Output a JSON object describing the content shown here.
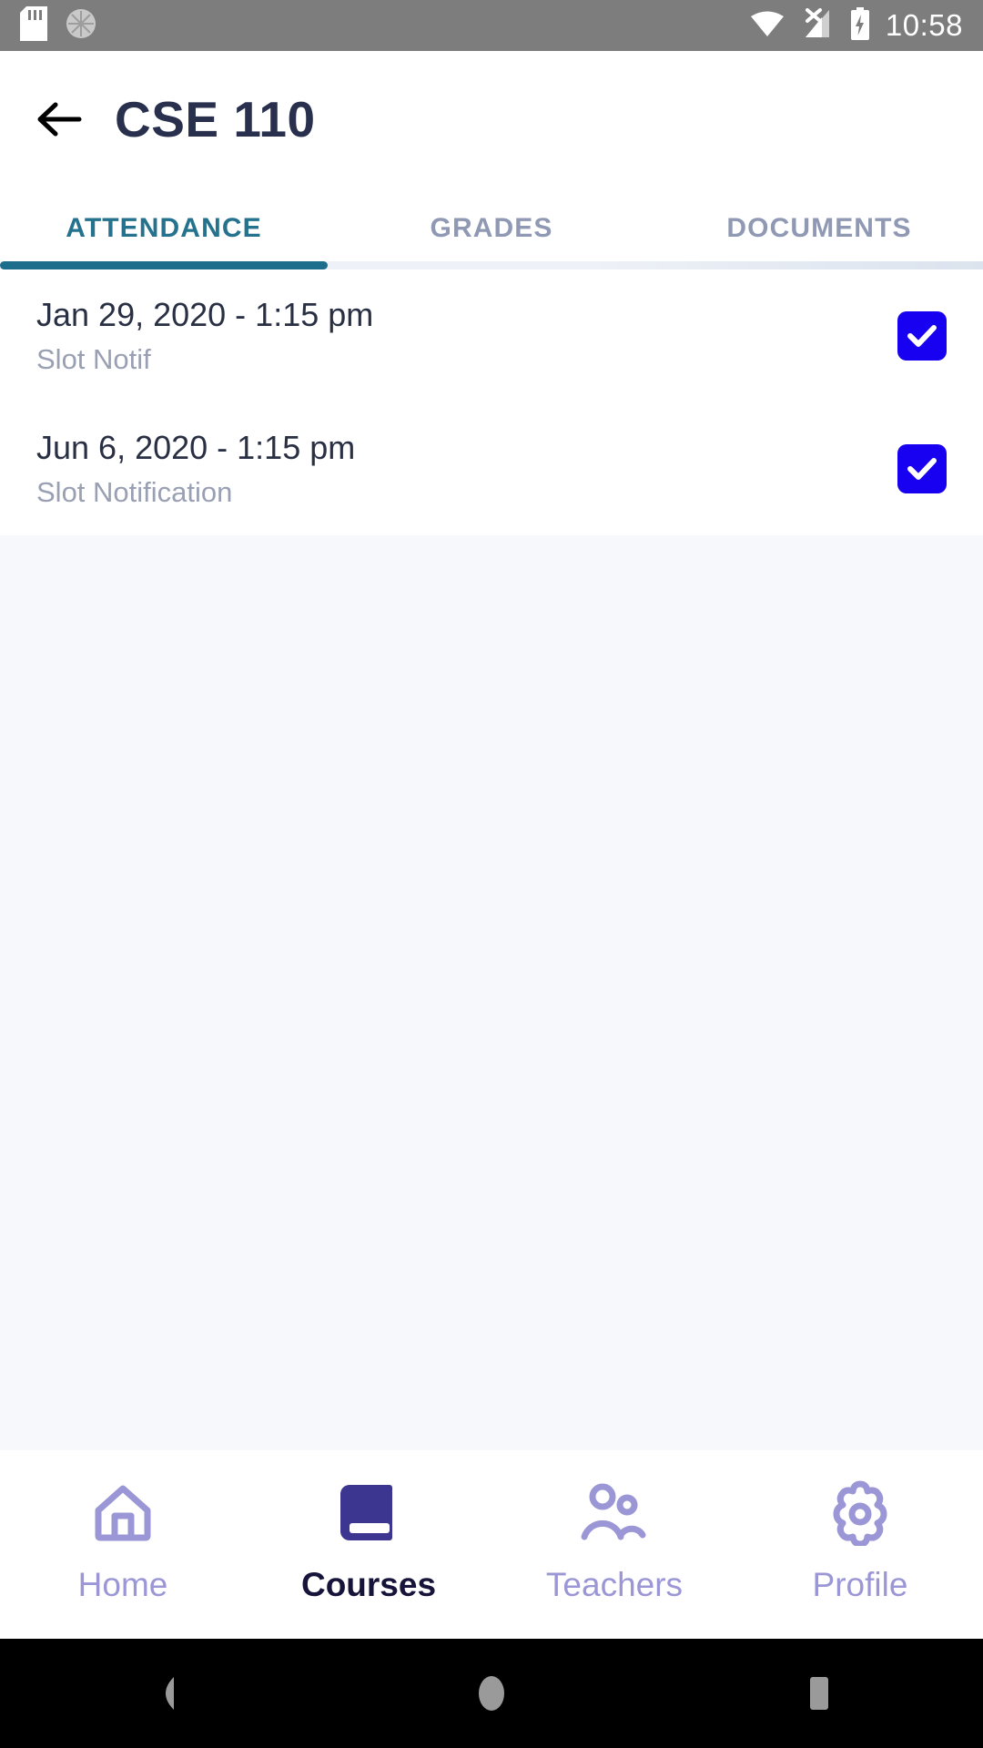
{
  "status_bar": {
    "time": "10:58",
    "icons": [
      "sd-card-icon",
      "sync-spinner-icon",
      "wifi-icon",
      "signal-no-sim-icon",
      "battery-charging-icon"
    ],
    "background": "#7d7d7d"
  },
  "app_bar": {
    "back_label": "back-arrow",
    "title": "CSE 110",
    "title_color": "#28304d"
  },
  "tabs": {
    "active_index": 0,
    "active_color": "#1d6e8c",
    "inactive_color": "#9099b4",
    "items": [
      {
        "label": "ATTENDANCE"
      },
      {
        "label": "GRADES"
      },
      {
        "label": "DOCUMENTS"
      }
    ]
  },
  "attendance": {
    "checkbox_color": "#1800f0",
    "items": [
      {
        "title": "Jan 29, 2020 - 1:15 pm",
        "subtitle": "Slot Notif",
        "checked": true
      },
      {
        "title": "Jun 6, 2020 - 1:15 pm",
        "subtitle": "Slot Notification",
        "checked": true
      }
    ]
  },
  "bottom_nav": {
    "active_index": 1,
    "active_color": "#16143a",
    "inactive_color": "#9b97d6",
    "items": [
      {
        "label": "Home",
        "icon": "home-icon"
      },
      {
        "label": "Courses",
        "icon": "book-icon"
      },
      {
        "label": "Teachers",
        "icon": "people-icon"
      },
      {
        "label": "Profile",
        "icon": "gear-icon"
      }
    ]
  },
  "android_nav": {
    "items": [
      {
        "name": "back",
        "icon": "triangle-back-icon"
      },
      {
        "name": "home",
        "icon": "circle-home-icon"
      },
      {
        "name": "recents",
        "icon": "square-recents-icon"
      }
    ]
  }
}
